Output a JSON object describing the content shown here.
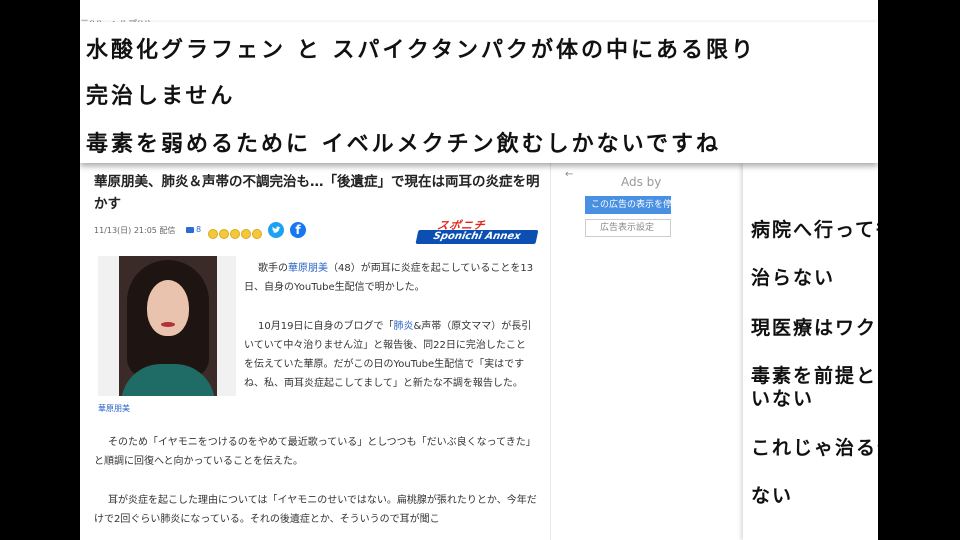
{
  "menu": {
    "view": "示(V)",
    "help": "ヘルプ(H)"
  },
  "caption": {
    "line1": "水酸化グラフェン と スパイクタンパクが体の中にある限り",
    "line2": "完治しません",
    "line3": "毒素を弱めるために イベルメクチン飲むしかないですね"
  },
  "article": {
    "headline": "華原朋美、肺炎＆声帯の不調完治も…「後遺症」で現在は両耳の炎症を明かす",
    "date": "11/13(日) 21:05 配信",
    "comment_count": "8",
    "logo_top": "スポニチ",
    "logo_bottom": "Sponichi Annex",
    "photo_caption": "華原朋美",
    "p1": {
      "pre": "歌手の",
      "link": "華原朋美",
      "post": "（48）が両耳に炎症を起こしていることを13日、自身のYouTube生配信で明かした。"
    },
    "p2": {
      "pre": "10月19日に自身のブログで「",
      "link": "肺炎",
      "post": "&声帯（原文ママ）が長引いていて中々治りません泣」と報告後、同22日に完治したことを伝えていた華原。だがこの日のYouTube生配信で「実はですね、私、両耳炎症起こしてまして」と新たな不調を報告した。"
    },
    "p3": "そのため「イヤモニをつけるのをやめて最近歌っている」としつつも「だいぶ良くなってきた」と順調に回復へと向かっていることを伝えた。",
    "p4": "耳が炎症を起こした理由については「イヤモニのせいではない。扁桃腺が張れたりとか、今年だけで2回ぐらい肺炎になっている。それの後遺症とか、そういうので耳が聞こ"
  },
  "ads": {
    "back": "←",
    "label": "Ads by",
    "button1": "この広告の表示を停止",
    "button2": "広告表示設定"
  },
  "side_caption": {
    "l1": "病院へ行っても",
    "l2": "治らない",
    "l3": "現医療はワクチン",
    "l4": "毒素を前提として",
    "l5": "いない",
    "l6": "これじゃ治る分け",
    "l7": "ない"
  },
  "colors": {
    "link": "#2a63c6",
    "twitter": "#1da1f2",
    "facebook": "#1877f2",
    "ads_button": "#4a90e2"
  }
}
